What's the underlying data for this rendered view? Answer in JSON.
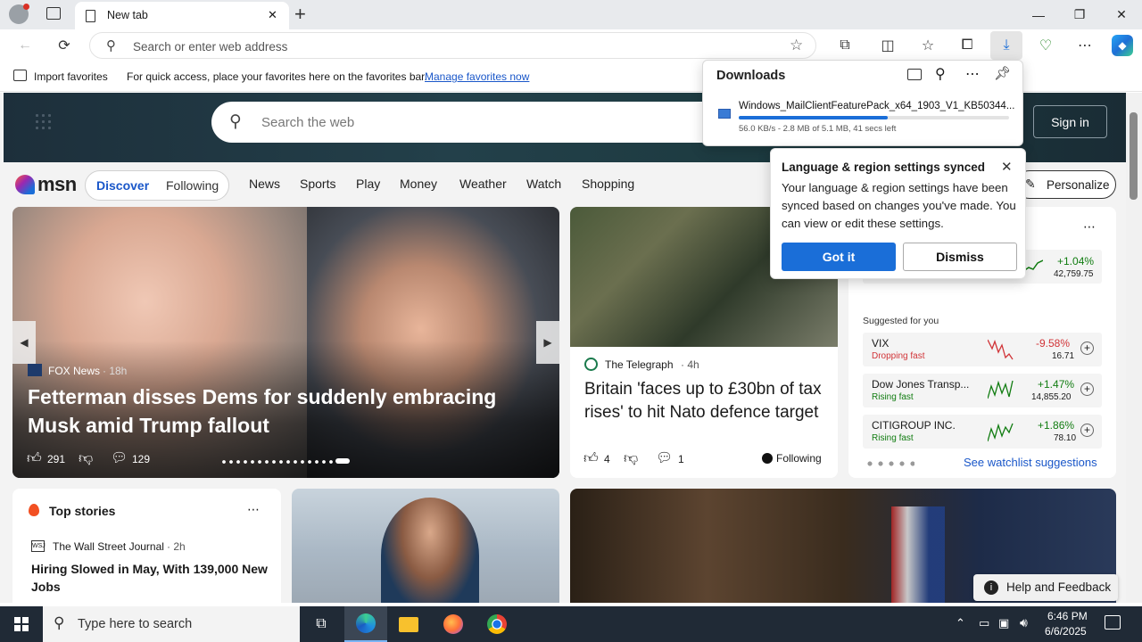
{
  "browser": {
    "tab_title": "New tab",
    "new_tab_label": "+",
    "address_placeholder": "Search or enter web address",
    "controls": {
      "minimize": "—",
      "restore": "❐",
      "close": "✕"
    }
  },
  "favorites_bar": {
    "import_label": "Import favorites",
    "hint": "For quick access, place your favorites here on the favorites bar.",
    "manage_link": "Manage favorites now"
  },
  "downloads": {
    "title": "Downloads",
    "file_name": "Windows_MailClientFeaturePack_x64_1903_V1_KB50344...",
    "status": "56.0 KB/s - 2.8 MB of 5.1 MB, 41 secs left",
    "progress_fraction": 0.55
  },
  "msn": {
    "search_placeholder": "Search the web",
    "sign_in": "Sign in",
    "logo_text": "msn",
    "tabs": [
      "Discover",
      "Following"
    ],
    "nav": [
      "News",
      "Sports",
      "Play",
      "Money",
      "Weather",
      "Watch",
      "Shopping"
    ],
    "personalize": "Personalize"
  },
  "lang_popup": {
    "title": "Language & region settings synced",
    "body": "Your language & region settings have been synced based on changes you've made. You can view or edit these settings.",
    "got_it": "Got it",
    "dismiss": "Dismiss"
  },
  "hero": {
    "source": "FOX News",
    "age": "· 18h",
    "headline": "Fetterman disses Dems for suddenly embracing Musk amid Trump fallout",
    "likes": "291",
    "comments": "129"
  },
  "card2": {
    "source": "The Telegraph",
    "age": "· 4h",
    "headline": "Britain 'faces up to £30bn of tax rises' to hit Nato defence target",
    "likes": "4",
    "comments": "1",
    "following": "Following"
  },
  "watchlist": {
    "top_change": "+1.04%",
    "top_value": "42,759.75",
    "suggested_label": "Suggested for you",
    "stocks": [
      {
        "name": "VIX",
        "trend": "Dropping fast",
        "change": "-9.58%",
        "value": "16.71",
        "color": "#d13438"
      },
      {
        "name": "Dow Jones Transp...",
        "trend": "Rising fast",
        "change": "+1.47%",
        "value": "14,855.20",
        "color": "#107c10"
      },
      {
        "name": "CITIGROUP INC.",
        "trend": "Rising fast",
        "change": "+1.86%",
        "value": "78.10",
        "color": "#107c10"
      }
    ],
    "see_suggestions": "See watchlist suggestions"
  },
  "top_stories": {
    "title": "Top stories",
    "source": "The Wall Street Journal",
    "age": "· 2h",
    "headline": "Hiring Slowed in May, With 139,000 New Jobs"
  },
  "feedback": {
    "label": "Help and Feedback"
  },
  "taskbar": {
    "search_placeholder": "Type here to search",
    "time": "6:46 PM",
    "date": "6/6/2025"
  },
  "colors": {
    "accent": "#1a6ed8",
    "taskbar": "#202a36",
    "link": "#1a57c9"
  }
}
